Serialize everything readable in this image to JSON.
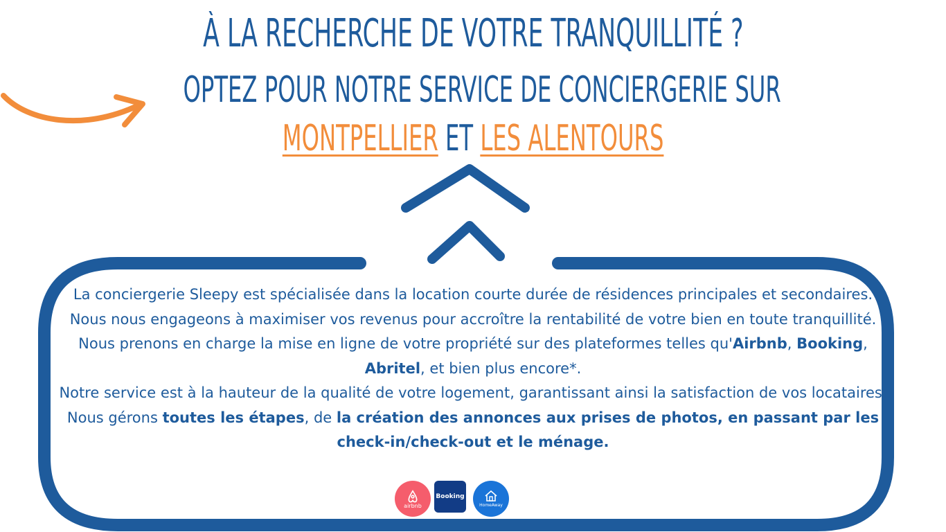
{
  "headline": {
    "line1": "À la recherche de votre tranquillité ?",
    "line2": "Optez pour notre service de conciergerie sur",
    "highlight1": "Montpellier",
    "connector": "et",
    "highlight2": "les alentours"
  },
  "body": {
    "p1": "La conciergerie Sleepy est spécialisée dans la location courte durée de résidences principales et secondaires. Nous nous engageons à maximiser vos revenus pour accroître la rentabilité de votre bien en toute tranquillité.",
    "p2_start": "Nous prenons en charge la mise en ligne de votre propriété sur des plateformes telles qu'",
    "platform1": "Airbnb",
    "sep1": ", ",
    "platform2": "Booking",
    "sep2": ", ",
    "platform3": "Abritel",
    "p2_end": ", et bien plus encore*.",
    "p3_start": "Notre service est à la hauteur de la qualité de votre logement, garantissant ainsi la satisfaction de vos locataires. Nous gérons ",
    "p3_bold1": "toutes les étapes",
    "p3_mid": ", de ",
    "p3_bold2": "la création des annonces aux prises de photos, en passant par les check-in/check-out et le ménage."
  },
  "logos": {
    "airbnb": "airbnb",
    "booking": "Booking",
    "homeaway": "HomeAway"
  },
  "colors": {
    "primary": "#1e5b9c",
    "accent": "#f28d3b"
  }
}
